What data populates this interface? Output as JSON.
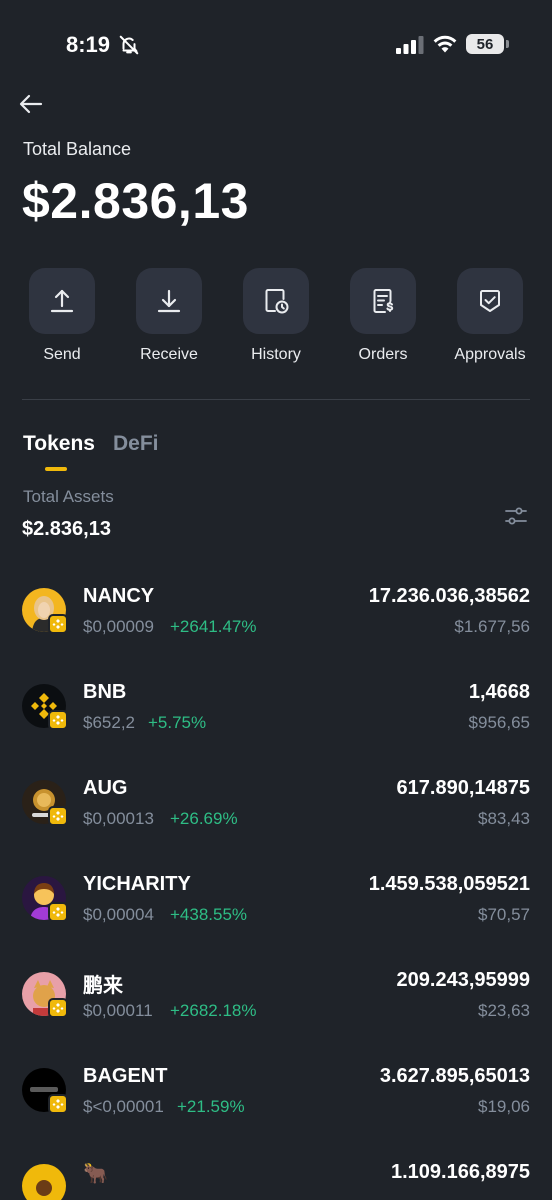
{
  "status": {
    "time": "8:19",
    "battery": "56"
  },
  "header": {
    "balance_label": "Total Balance",
    "balance": "$2.836,13"
  },
  "actions": [
    {
      "label": "Send",
      "icon": "upload-icon"
    },
    {
      "label": "Receive",
      "icon": "download-icon"
    },
    {
      "label": "History",
      "icon": "history-icon"
    },
    {
      "label": "Orders",
      "icon": "orders-icon"
    },
    {
      "label": "Approvals",
      "icon": "approvals-icon"
    }
  ],
  "tabs": {
    "tokens": "Tokens",
    "defi": "DeFi",
    "active": "Tokens"
  },
  "assets": {
    "label": "Total Assets",
    "value": "$2.836,13"
  },
  "colors": {
    "background": "#1f2329",
    "accent": "#f0b90b",
    "positive": "#2ebd85",
    "negative": "#f6465d",
    "muted": "#848e9c"
  },
  "tokens": [
    {
      "name": "NANCY",
      "price": "$0,00009",
      "change": "+2641.47%",
      "amount": "17.236.036,38562",
      "value": "$1.677,56"
    },
    {
      "name": "BNB",
      "price": "$652,2",
      "change": "+5.75%",
      "amount": "1,4668",
      "value": "$956,65"
    },
    {
      "name": "AUG",
      "price": "$0,00013",
      "change": "+26.69%",
      "amount": "617.890,14875",
      "value": "$83,43"
    },
    {
      "name": "YICHARITY",
      "price": "$0,00004",
      "change": "+438.55%",
      "amount": "1.459.538,059521",
      "value": "$70,57"
    },
    {
      "name": "鹏来",
      "price": "$0,00011",
      "change": "+2682.18%",
      "amount": "209.243,95999",
      "value": "$23,63"
    },
    {
      "name": "BAGENT",
      "price": "$<0,00001",
      "change": "+21.59%",
      "amount": "3.627.895,65013",
      "value": "$19,06"
    },
    {
      "name": "🐂",
      "price": "",
      "change": "",
      "amount": "1.109.166,8975",
      "value": ""
    }
  ]
}
